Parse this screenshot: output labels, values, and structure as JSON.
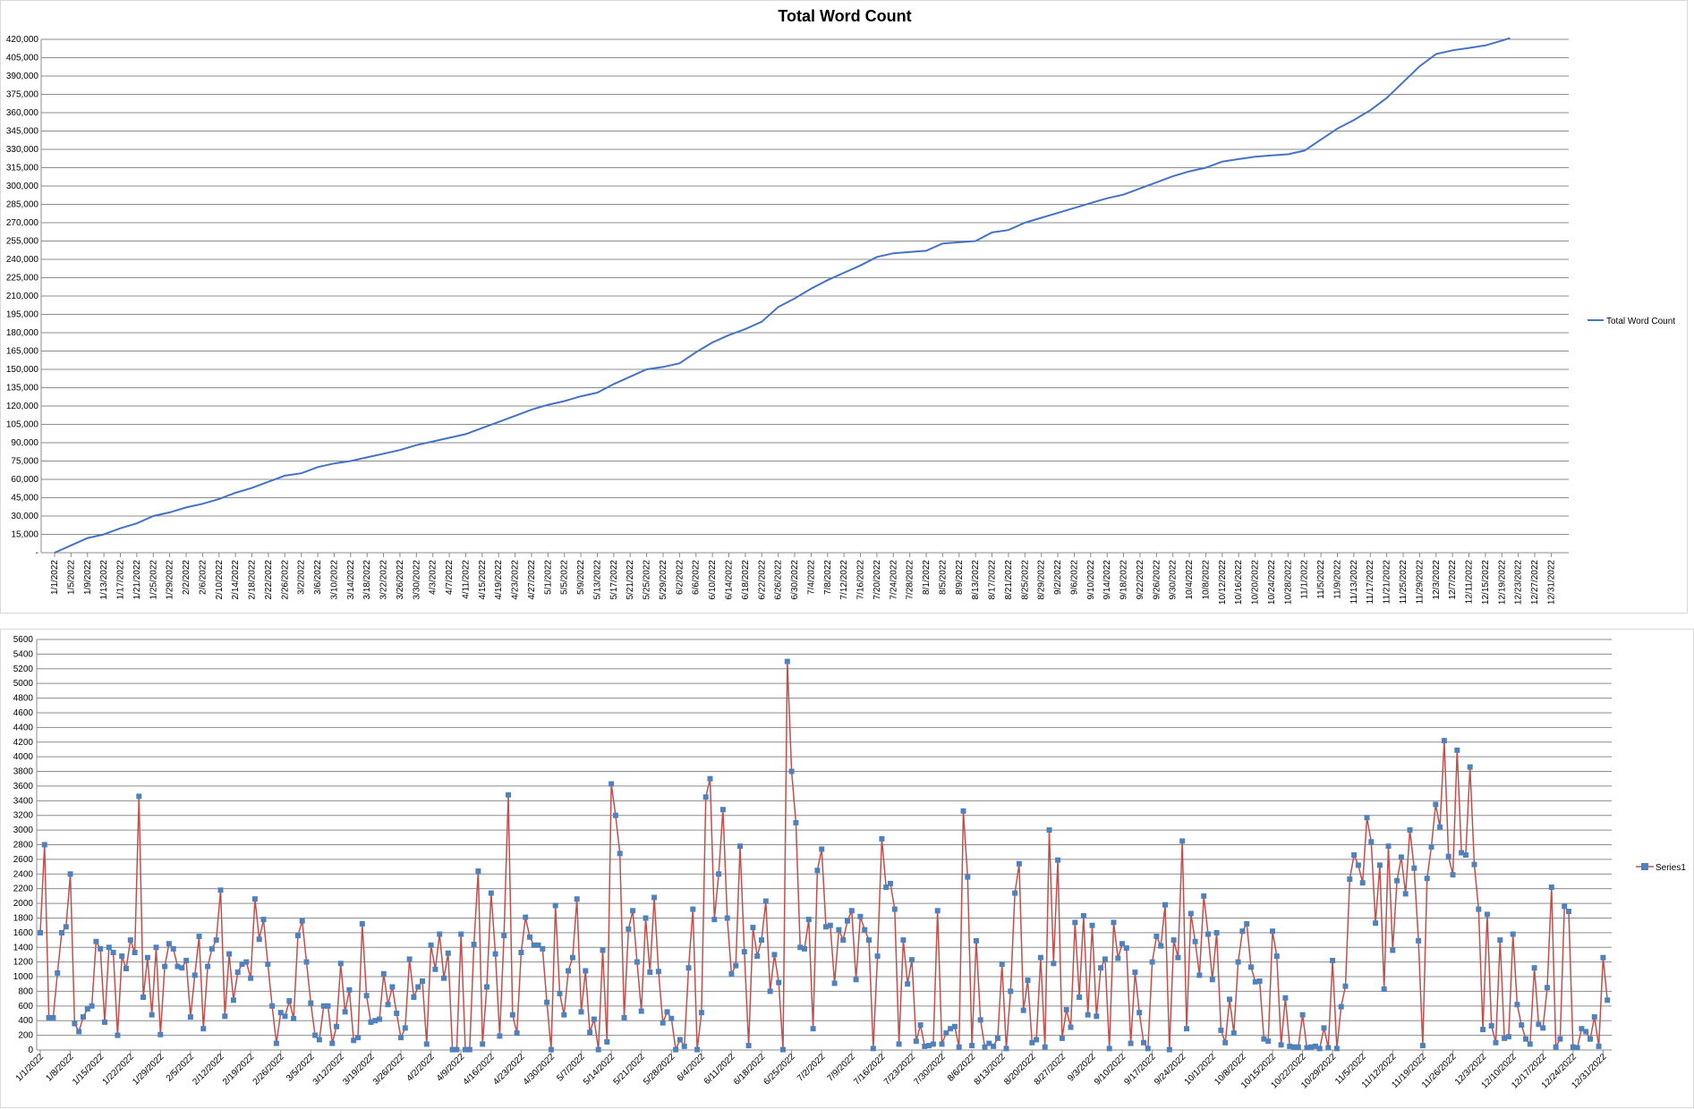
{
  "chart_data": [
    {
      "type": "line",
      "title": "Total Word Count",
      "xlabel": "",
      "ylabel": "",
      "ylim": [
        0,
        420000
      ],
      "yticks": [
        "-",
        "15,000",
        "30,000",
        "45,000",
        "60,000",
        "75,000",
        "90,000",
        "105,000",
        "120,000",
        "135,000",
        "150,000",
        "165,000",
        "180,000",
        "195,000",
        "210,000",
        "225,000",
        "240,000",
        "255,000",
        "270,000",
        "285,000",
        "300,000",
        "315,000",
        "330,000",
        "345,000",
        "360,000",
        "375,000",
        "390,000",
        "405,000",
        "420,000"
      ],
      "xticks": [
        "1/1/2022",
        "1/5/2022",
        "1/9/2022",
        "1/13/2022",
        "1/17/2022",
        "1/21/2022",
        "1/25/2022",
        "1/29/2022",
        "2/2/2022",
        "2/6/2022",
        "2/10/2022",
        "2/14/2022",
        "2/18/2022",
        "2/22/2022",
        "2/26/2022",
        "3/2/2022",
        "3/6/2022",
        "3/10/2022",
        "3/14/2022",
        "3/18/2022",
        "3/22/2022",
        "3/26/2022",
        "3/30/2022",
        "4/3/2022",
        "4/7/2022",
        "4/11/2022",
        "4/15/2022",
        "4/19/2022",
        "4/23/2022",
        "4/27/2022",
        "5/1/2022",
        "5/5/2022",
        "5/9/2022",
        "5/13/2022",
        "5/17/2022",
        "5/21/2022",
        "5/25/2022",
        "5/29/2022",
        "6/2/2022",
        "6/6/2022",
        "6/10/2022",
        "6/14/2022",
        "6/18/2022",
        "6/22/2022",
        "6/26/2022",
        "6/30/2022",
        "7/4/2022",
        "7/8/2022",
        "7/12/2022",
        "7/16/2022",
        "7/20/2022",
        "7/24/2022",
        "7/28/2022",
        "8/1/2022",
        "8/5/2022",
        "8/9/2022",
        "8/13/2022",
        "8/17/2022",
        "8/21/2022",
        "8/25/2022",
        "8/29/2022",
        "9/2/2022",
        "9/6/2022",
        "9/10/2022",
        "9/14/2022",
        "9/18/2022",
        "9/22/2022",
        "9/26/2022",
        "9/30/2022",
        "10/4/2022",
        "10/8/2022",
        "10/12/2022",
        "10/16/2022",
        "10/20/2022",
        "10/24/2022",
        "10/28/2022",
        "11/1/2022",
        "11/5/2022",
        "11/9/2022",
        "11/13/2022",
        "11/17/2022",
        "11/21/2022",
        "11/25/2022",
        "11/29/2022",
        "12/3/2022",
        "12/7/2022",
        "12/11/2022",
        "12/15/2022",
        "12/19/2022",
        "12/23/2022",
        "12/27/2022",
        "12/31/2022"
      ],
      "grid": true,
      "legend_position": "right",
      "color": "#4472c4",
      "series": [
        {
          "name": "Total Word Count",
          "points": [
            [
              "1/1/2022",
              0
            ],
            [
              "1/5/2022",
              6000
            ],
            [
              "1/9/2022",
              12000
            ],
            [
              "1/13/2022",
              15000
            ],
            [
              "1/17/2022",
              20000
            ],
            [
              "1/21/2022",
              24000
            ],
            [
              "1/25/2022",
              30000
            ],
            [
              "1/29/2022",
              33000
            ],
            [
              "2/2/2022",
              37000
            ],
            [
              "2/6/2022",
              40000
            ],
            [
              "2/10/2022",
              44000
            ],
            [
              "2/14/2022",
              49000
            ],
            [
              "2/18/2022",
              53000
            ],
            [
              "2/22/2022",
              58000
            ],
            [
              "2/26/2022",
              63000
            ],
            [
              "3/2/2022",
              65000
            ],
            [
              "3/6/2022",
              70000
            ],
            [
              "3/10/2022",
              73000
            ],
            [
              "3/14/2022",
              75000
            ],
            [
              "3/18/2022",
              78000
            ],
            [
              "3/22/2022",
              81000
            ],
            [
              "3/26/2022",
              84000
            ],
            [
              "3/30/2022",
              88000
            ],
            [
              "4/3/2022",
              91000
            ],
            [
              "4/7/2022",
              94000
            ],
            [
              "4/11/2022",
              97000
            ],
            [
              "4/15/2022",
              102000
            ],
            [
              "4/19/2022",
              107000
            ],
            [
              "4/23/2022",
              112000
            ],
            [
              "4/27/2022",
              117000
            ],
            [
              "5/1/2022",
              121000
            ],
            [
              "5/5/2022",
              124000
            ],
            [
              "5/9/2022",
              128000
            ],
            [
              "5/13/2022",
              131000
            ],
            [
              "5/17/2022",
              138000
            ],
            [
              "5/21/2022",
              144000
            ],
            [
              "5/25/2022",
              150000
            ],
            [
              "5/29/2022",
              152000
            ],
            [
              "6/2/2022",
              155000
            ],
            [
              "6/6/2022",
              164000
            ],
            [
              "6/10/2022",
              172000
            ],
            [
              "6/14/2022",
              178000
            ],
            [
              "6/18/2022",
              183000
            ],
            [
              "6/22/2022",
              189000
            ],
            [
              "6/26/2022",
              201000
            ],
            [
              "6/30/2022",
              208000
            ],
            [
              "7/4/2022",
              216000
            ],
            [
              "7/8/2022",
              223000
            ],
            [
              "7/12/2022",
              229000
            ],
            [
              "7/16/2022",
              235000
            ],
            [
              "7/20/2022",
              242000
            ],
            [
              "7/24/2022",
              245000
            ],
            [
              "7/28/2022",
              246000
            ],
            [
              "8/1/2022",
              247000
            ],
            [
              "8/5/2022",
              253000
            ],
            [
              "8/9/2022",
              254000
            ],
            [
              "8/13/2022",
              255000
            ],
            [
              "8/17/2022",
              262000
            ],
            [
              "8/21/2022",
              264000
            ],
            [
              "8/25/2022",
              270000
            ],
            [
              "8/29/2022",
              274000
            ],
            [
              "9/2/2022",
              278000
            ],
            [
              "9/6/2022",
              282000
            ],
            [
              "9/10/2022",
              286000
            ],
            [
              "9/14/2022",
              290000
            ],
            [
              "9/18/2022",
              293000
            ],
            [
              "9/22/2022",
              298000
            ],
            [
              "9/26/2022",
              303000
            ],
            [
              "9/30/2022",
              308000
            ],
            [
              "10/4/2022",
              312000
            ],
            [
              "10/8/2022",
              315000
            ],
            [
              "10/12/2022",
              320000
            ],
            [
              "10/16/2022",
              322000
            ],
            [
              "10/20/2022",
              324000
            ],
            [
              "10/24/2022",
              325000
            ],
            [
              "10/28/2022",
              326000
            ],
            [
              "11/1/2022",
              329000
            ],
            [
              "11/5/2022",
              338000
            ],
            [
              "11/9/2022",
              347000
            ],
            [
              "11/13/2022",
              354000
            ],
            [
              "11/17/2022",
              362000
            ],
            [
              "11/21/2022",
              372000
            ],
            [
              "11/25/2022",
              385000
            ],
            [
              "11/29/2022",
              398000
            ],
            [
              "12/3/2022",
              408000
            ],
            [
              "12/7/2022",
              411000
            ],
            [
              "12/11/2022",
              413000
            ],
            [
              "12/15/2022",
              415000
            ],
            [
              "12/19/2022",
              419000
            ],
            [
              "12/21/2022",
              421000
            ]
          ]
        }
      ]
    },
    {
      "type": "line",
      "title": "",
      "xlabel": "",
      "ylabel": "",
      "ylim": [
        0,
        5600
      ],
      "yticks": [
        "0",
        "200",
        "400",
        "600",
        "800",
        "1000",
        "1200",
        "1400",
        "1600",
        "1800",
        "2000",
        "2200",
        "2400",
        "2600",
        "2800",
        "3000",
        "3200",
        "3400",
        "3600",
        "3800",
        "4000",
        "4200",
        "4400",
        "4600",
        "4800",
        "5000",
        "5200",
        "5400",
        "5600"
      ],
      "xticks": [
        "1/1/2022",
        "1/8/2022",
        "1/15/2022",
        "1/22/2022",
        "1/29/2022",
        "2/5/2022",
        "2/12/2022",
        "2/19/2022",
        "2/26/2022",
        "3/5/2022",
        "3/12/2022",
        "3/19/2022",
        "3/26/2022",
        "4/2/2022",
        "4/9/2022",
        "4/16/2022",
        "4/23/2022",
        "4/30/2022",
        "5/7/2022",
        "5/14/2022",
        "5/21/2022",
        "5/28/2022",
        "6/4/2022",
        "6/11/2022",
        "6/18/2022",
        "6/25/2022",
        "7/2/2022",
        "7/9/2022",
        "7/16/2022",
        "7/23/2022",
        "7/30/2022",
        "8/6/2022",
        "8/13/2022",
        "8/20/2022",
        "8/27/2022",
        "9/3/2022",
        "9/10/2022",
        "9/17/2022",
        "9/24/2022",
        "10/1/2022",
        "10/8/2022",
        "10/15/2022",
        "10/22/2022",
        "10/29/2022",
        "11/5/2022",
        "11/12/2022",
        "11/19/2022",
        "11/26/2022",
        "12/3/2022",
        "12/10/2022",
        "12/17/2022",
        "12/24/2022",
        "12/31/2022"
      ],
      "grid": true,
      "legend_position": "right",
      "line_color": "#c0504d",
      "marker_color": "#4f81bd",
      "series": [
        {
          "name": "Series1",
          "start_date": "1/1/2022",
          "values": [
            1600,
            2800,
            440,
            440,
            1050,
            1600,
            1680,
            2400,
            360,
            250,
            450,
            560,
            600,
            1480,
            1380,
            380,
            1400,
            1330,
            200,
            1280,
            1110,
            1500,
            1330,
            3460,
            720,
            1260,
            480,
            1400,
            210,
            1140,
            1450,
            1380,
            1140,
            1120,
            1220,
            450,
            1020,
            1550,
            290,
            1140,
            1380,
            1500,
            2180,
            460,
            1310,
            680,
            1060,
            1170,
            1200,
            980,
            2060,
            1510,
            1780,
            1170,
            600,
            90,
            510,
            460,
            670,
            430,
            1560,
            1760,
            1200,
            640,
            200,
            140,
            600,
            600,
            90,
            320,
            1180,
            520,
            820,
            130,
            170,
            1720,
            740,
            380,
            400,
            420,
            1040,
            620,
            860,
            500,
            170,
            300,
            1240,
            720,
            860,
            940,
            80,
            1430,
            1100,
            1580,
            980,
            1320,
            5,
            5,
            1580,
            5,
            5,
            1440,
            2440,
            80,
            860,
            2140,
            1310,
            190,
            1560,
            3480,
            480,
            230,
            1330,
            1810,
            1540,
            1430,
            1430,
            1380,
            650,
            5,
            1970,
            770,
            480,
            1080,
            1260,
            2060,
            520,
            1080,
            240,
            420,
            5,
            1360,
            110,
            3630,
            3200,
            2680,
            440,
            1650,
            1900,
            1200,
            530,
            1800,
            1060,
            2080,
            1070,
            370,
            520,
            430,
            5,
            140,
            50,
            1120,
            1920,
            5,
            510,
            3450,
            3700,
            1780,
            2400,
            3280,
            1800,
            1040,
            1150,
            2780,
            1340,
            60,
            1670,
            1280,
            1500,
            2030,
            800,
            1300,
            920,
            5,
            5300,
            3800,
            3100,
            1400,
            1380,
            1780,
            290,
            2450,
            2740,
            1680,
            1700,
            910,
            1640,
            1500,
            1760,
            1900,
            960,
            1820,
            1640,
            1500,
            20,
            1280,
            2880,
            2220,
            2270,
            1920,
            80,
            1500,
            900,
            1230,
            120,
            340,
            50,
            60,
            80,
            1900,
            80,
            230,
            290,
            320,
            40,
            3260,
            2360,
            60,
            1490,
            410,
            40,
            90,
            50,
            160,
            1170,
            20,
            800,
            2140,
            2540,
            540,
            950,
            100,
            140,
            1260,
            40,
            3000,
            1180,
            2590,
            160,
            550,
            310,
            1740,
            720,
            1830,
            480,
            1700,
            460,
            1120,
            1240,
            20,
            1740,
            1250,
            1450,
            1390,
            90,
            1060,
            510,
            100,
            20,
            1200,
            1550,
            1420,
            1980,
            5,
            1500,
            1260,
            2850,
            290,
            1860,
            1480,
            1020,
            2100,
            1580,
            960,
            1600,
            270,
            100,
            690,
            230,
            1200,
            1620,
            1720,
            1130,
            930,
            940,
            150,
            120,
            1620,
            1280,
            70,
            710,
            50,
            40,
            40,
            480,
            30,
            40,
            50,
            20,
            300,
            30,
            1220,
            20,
            590,
            870,
            2330,
            2660,
            2520,
            2280,
            3170,
            2840,
            1730,
            2520,
            830,
            2780,
            1360,
            2310,
            2630,
            2130,
            3000,
            2480,
            1490,
            60,
            2340,
            2770,
            3350,
            3040,
            4220,
            2640,
            2390,
            4090,
            2690,
            2660,
            3860,
            2530,
            1920,
            280,
            1850,
            330,
            100,
            1500,
            160,
            180,
            1580,
            620,
            340,
            150,
            80,
            1120,
            350,
            300,
            850,
            2220,
            40,
            150,
            1960,
            1890,
            40,
            30,
            290,
            250,
            150,
            450,
            50,
            1260,
            680
          ]
        }
      ]
    }
  ]
}
